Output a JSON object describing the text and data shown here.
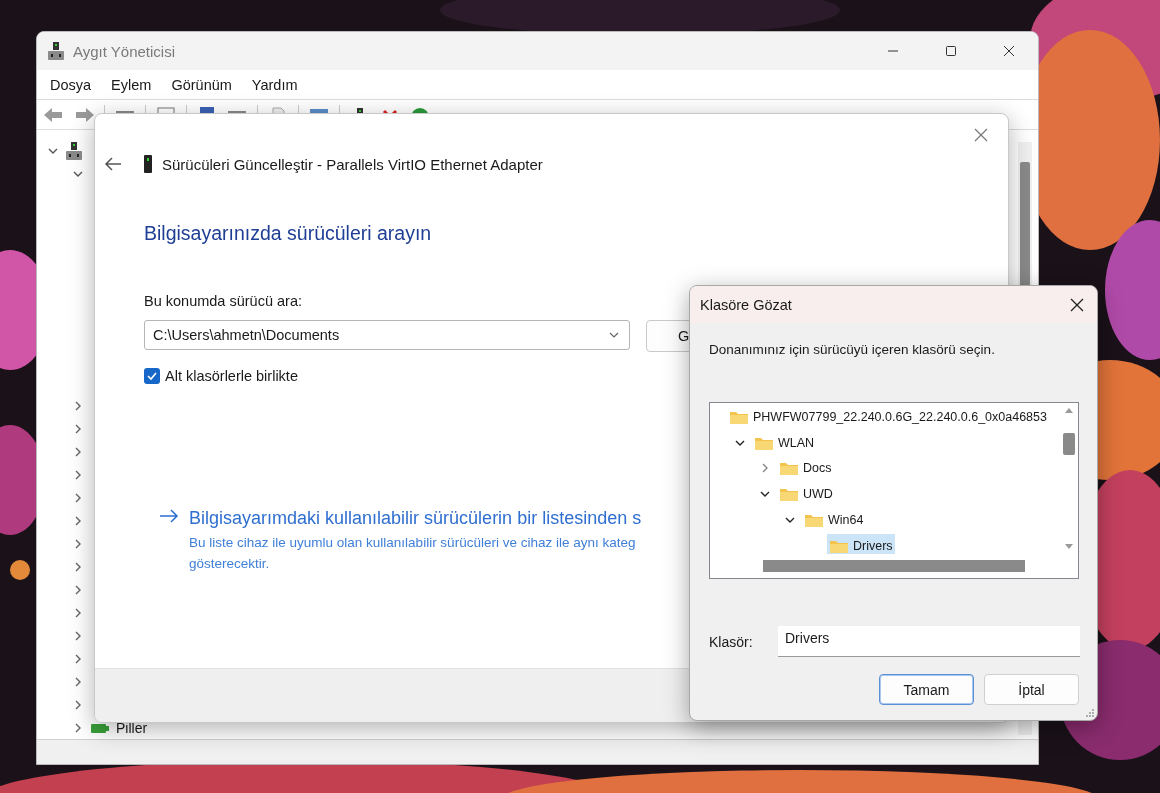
{
  "main_window": {
    "title": "Aygıt Yöneticisi",
    "menu": [
      "Dosya",
      "Eylem",
      "Görünüm",
      "Yardım"
    ],
    "device_tree": [
      {
        "expanded": true,
        "children": [
          {
            "expanded": true
          },
          {
            "expanded": false
          },
          {
            "expanded": false
          },
          {
            "expanded": false
          },
          {
            "expanded": false
          },
          {
            "expanded": false
          },
          {
            "expanded": false
          },
          {
            "expanded": false
          },
          {
            "expanded": false
          },
          {
            "expanded": false
          },
          {
            "expanded": false
          },
          {
            "expanded": false
          },
          {
            "expanded": false
          },
          {
            "expanded": false
          },
          {
            "expanded": false
          },
          {
            "expanded": false,
            "label": "Piller"
          }
        ]
      }
    ]
  },
  "wizard": {
    "title": "Sürücüleri Güncelleştir - Parallels VirtIO Ethernet Adapter",
    "heading": "Bilgisayarınızda sürücüleri arayın",
    "path_label": "Bu konumda sürücü ara:",
    "path_value": "C:\\Users\\ahmetn\\Documents",
    "browse_button": "G",
    "subfolders": {
      "label": "Alt klasörlerle birlikte",
      "checked": true
    },
    "pick_link": "Bilgisayarımdaki kullanılabilir sürücülerin bir listesinden s",
    "pick_description": "Bu liste cihaz ile uyumlu olan kullanılabilir sürücüleri ve cihaz ile aynı kateg\ngösterecektir."
  },
  "browse_dialog": {
    "title": "Klasöre Gözat",
    "instruction": "Donanımınız için sürücüyü içeren klasörü seçin.",
    "folders": [
      {
        "name": "PHWFW07799_22.240.0.6G_22.240.0.6_0x0a46853",
        "selected": false,
        "children": [
          {
            "name": "WLAN",
            "expanded": true,
            "selected": false,
            "children": [
              {
                "name": "Docs",
                "expanded": false,
                "selected": false
              },
              {
                "name": "UWD",
                "expanded": true,
                "selected": false,
                "children": [
                  {
                    "name": "Win64",
                    "expanded": true,
                    "selected": false,
                    "children": [
                      {
                        "name": "Drivers",
                        "selected": true
                      }
                    ]
                  }
                ]
              }
            ]
          }
        ]
      }
    ],
    "folder_label": "Klasör:",
    "folder_value": "Drivers",
    "buttons": [
      {
        "label": "Tamam",
        "default": true
      },
      {
        "label": "İptal",
        "default": false
      }
    ]
  }
}
